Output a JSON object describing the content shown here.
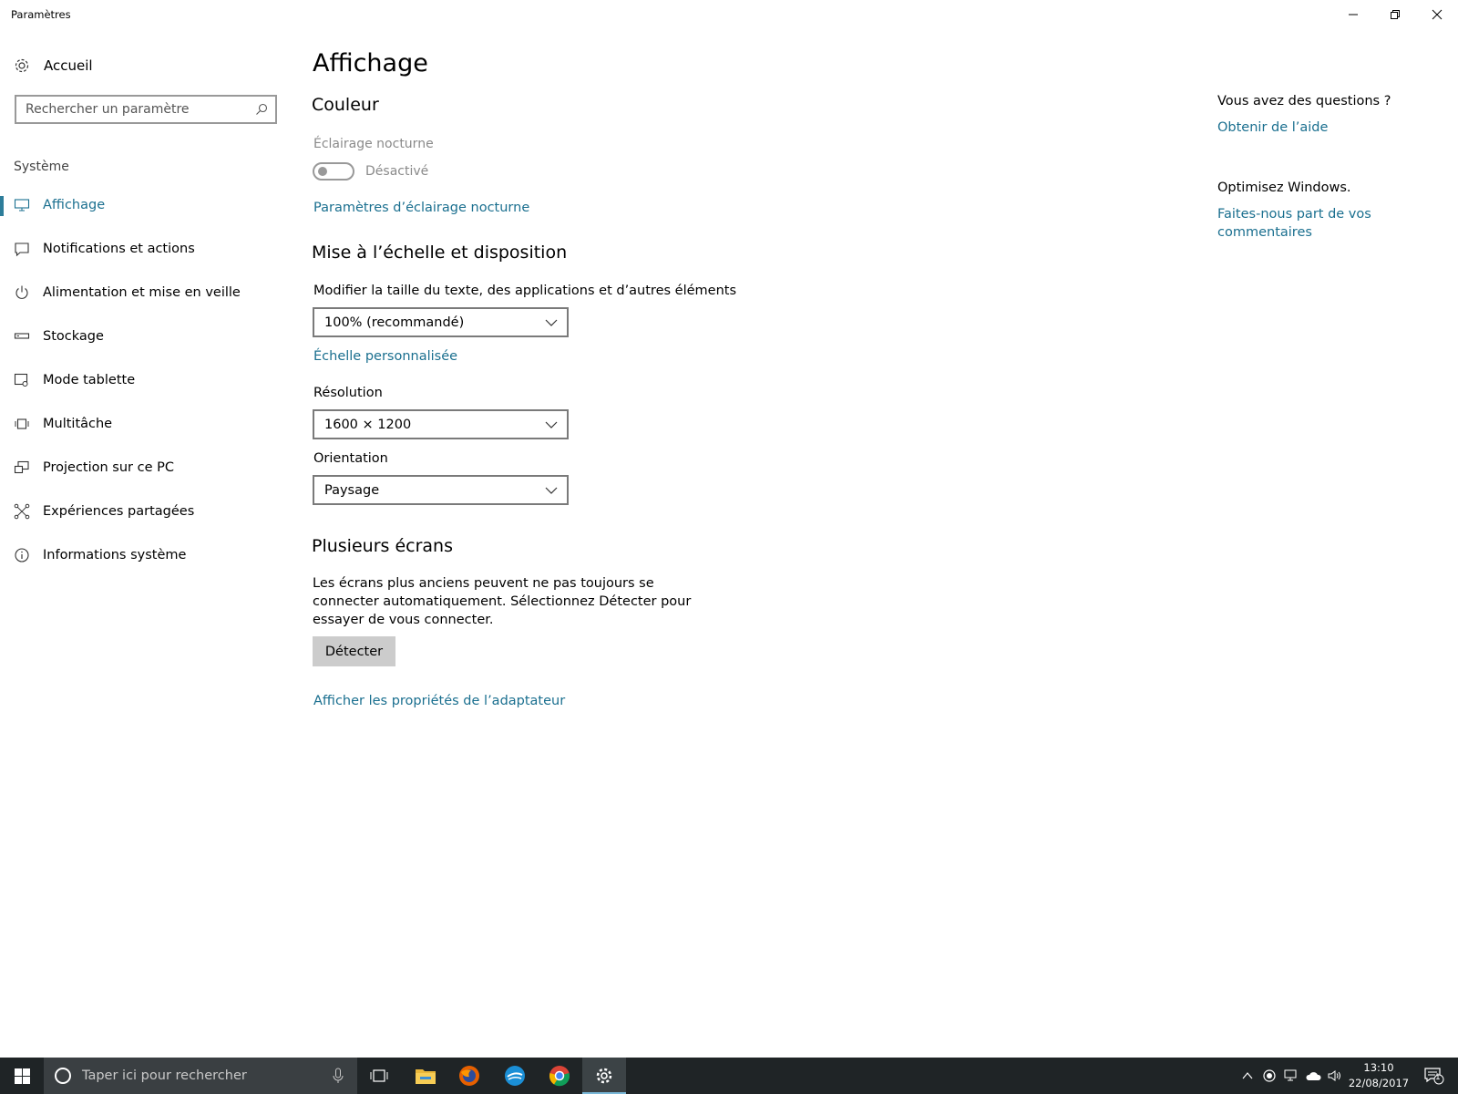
{
  "window": {
    "title": "Paramètres",
    "controls": {
      "minimize": "minimize",
      "restore": "restore",
      "close": "close"
    }
  },
  "sidebar": {
    "home_label": "Accueil",
    "search_placeholder": "Rechercher un paramètre",
    "group_label": "Système",
    "items": [
      {
        "label": "Affichage",
        "icon": "monitor-icon",
        "active": true
      },
      {
        "label": "Notifications et actions",
        "icon": "notification-icon"
      },
      {
        "label": "Alimentation et mise en veille",
        "icon": "power-icon"
      },
      {
        "label": "Stockage",
        "icon": "storage-icon"
      },
      {
        "label": "Mode tablette",
        "icon": "tablet-mode-icon"
      },
      {
        "label": "Multitâche",
        "icon": "multitask-icon"
      },
      {
        "label": "Projection sur ce PC",
        "icon": "projection-icon"
      },
      {
        "label": "Expériences partagées",
        "icon": "shared-experiences-icon"
      },
      {
        "label": "Informations système",
        "icon": "info-icon"
      }
    ]
  },
  "main": {
    "title": "Affichage",
    "color_section": {
      "heading": "Couleur",
      "night_light_label": "Éclairage nocturne",
      "toggle_state": "Désactivé",
      "night_light_settings_link": "Paramètres d’éclairage nocturne"
    },
    "scale_section": {
      "heading": "Mise à l’échelle et disposition",
      "size_label": "Modifier la taille du texte, des applications et d’autres éléments",
      "size_value": "100% (recommandé)",
      "custom_scale_link": "Échelle personnalisée",
      "resolution_label": "Résolution",
      "resolution_value": "1600 × 1200",
      "orientation_label": "Orientation",
      "orientation_value": "Paysage"
    },
    "multi_section": {
      "heading": "Plusieurs écrans",
      "description": "Les écrans plus anciens peuvent ne pas toujours se connecter automatiquement. Sélectionnez Détecter pour essayer de vous connecter.",
      "detect_button": "Détecter",
      "adapter_link": "Afficher les propriétés de l’adaptateur"
    }
  },
  "right_panel": {
    "questions_heading": "Vous avez des questions ?",
    "help_link": "Obtenir de l’aide",
    "improve_heading": "Optimisez Windows.",
    "feedback_link": "Faites-nous part de vos commentaires"
  },
  "taskbar": {
    "search_placeholder": "Taper ici pour rechercher",
    "time": "13:10",
    "date": "22/08/2017",
    "notification_count": "1",
    "apps": [
      "task-view-icon",
      "file-explorer-icon",
      "firefox-icon",
      "app-icon",
      "chrome-icon",
      "settings-icon"
    ]
  },
  "colors": {
    "accent_link": "#1a6f8f",
    "active_indicator": "#2d7d9a",
    "taskbar_bg": "#1f2426",
    "button_bg": "#cccccc"
  }
}
